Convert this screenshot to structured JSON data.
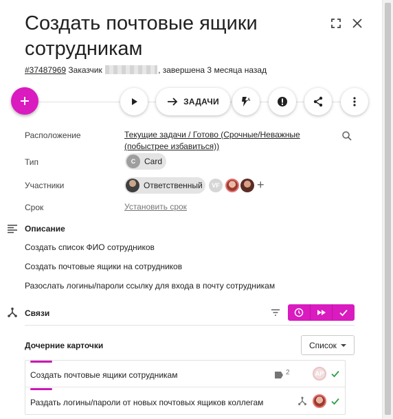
{
  "header": {
    "title": "Создать почтовые ящики сотрудникам",
    "card_number": "#37487969",
    "customer_label": "Заказчик",
    "status_text": ", завершена 3 месяца назад"
  },
  "toolbar": {
    "add_icon": "plus-icon",
    "play_icon": "play-icon",
    "tasks_label": "ЗАДАЧИ",
    "flash_icon": "flash-auto-icon",
    "alert_icon": "alert-icon",
    "share_icon": "share-icon",
    "more_icon": "more-vert-icon"
  },
  "fields": {
    "location_label": "Расположение",
    "location_value": "Текущие задачи / Готово (Срочные/Неважные (побыстрее избавиться))",
    "type_label": "Тип",
    "type_avatar": "C",
    "type_value": "Card",
    "participants_label": "Участники",
    "responsible_label": "Ответственный",
    "participant_initials": "VF",
    "deadline_label": "Срок",
    "deadline_action": "Установить срок"
  },
  "description": {
    "title": "Описание",
    "lines": [
      "Создать список ФИО сотрудников",
      "Создать почтовые ящики на сотрудников",
      "Разослать логины/пароли ссылку для входа в почту сотрудникам"
    ]
  },
  "links": {
    "title": "Связи"
  },
  "children": {
    "title": "Дочерние карточки",
    "list_view": "Список",
    "items": [
      {
        "title": "Создать почтовые ящики сотрудникам",
        "count": "2",
        "avatar": "AP"
      },
      {
        "title": "Раздать логины/пароли от новых почтовых ящиков коллегам"
      }
    ]
  },
  "colors": {
    "accent": "#d91bbf",
    "done": "#2e9e48"
  }
}
